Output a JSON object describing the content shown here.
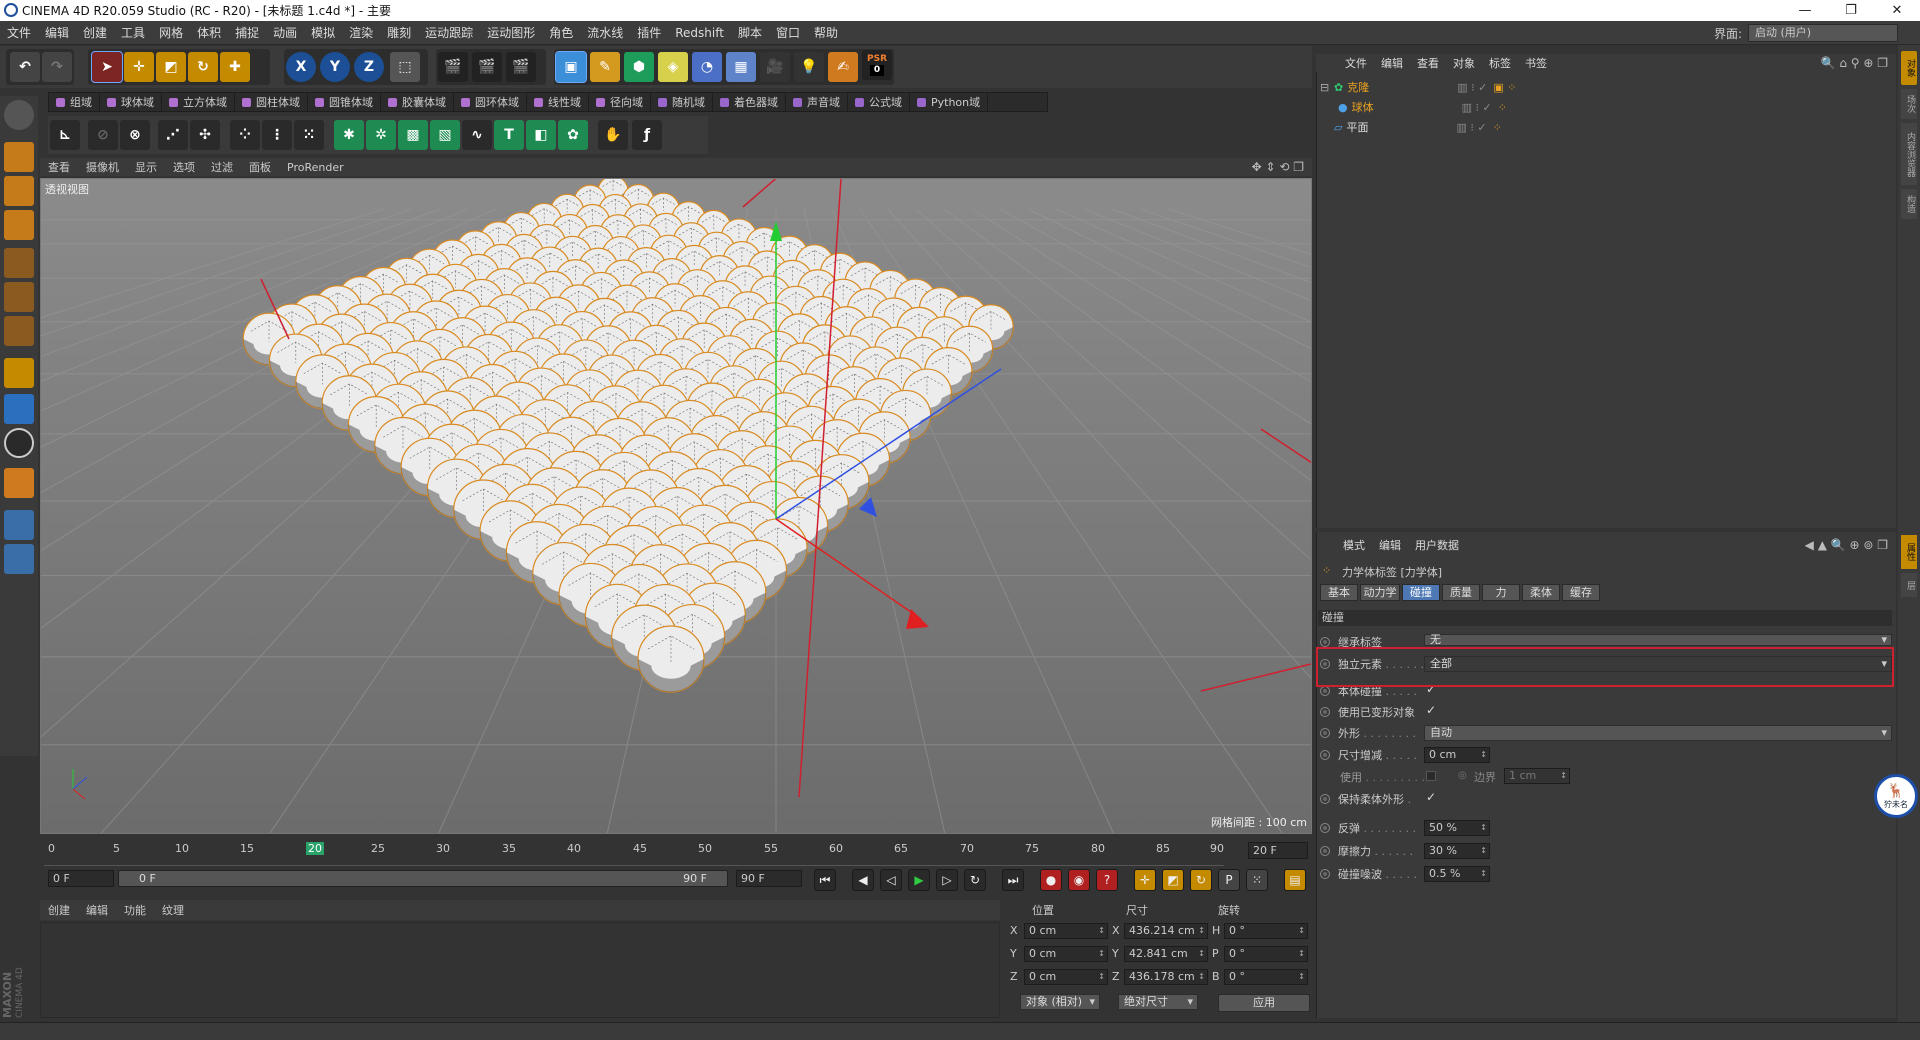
{
  "window": {
    "title": "CINEMA 4D R20.059 Studio (RC - R20) - [未标题 1.c4d *] - 主要",
    "min": "—",
    "max": "❐",
    "close": "✕"
  },
  "menubar": {
    "items": [
      "文件",
      "编辑",
      "创建",
      "工具",
      "网格",
      "体积",
      "捕捉",
      "动画",
      "模拟",
      "渲染",
      "雕刻",
      "运动跟踪",
      "运动图形",
      "角色",
      "流水线",
      "插件",
      "Redshift",
      "脚本",
      "窗口",
      "帮助"
    ],
    "layout_label": "界面:",
    "layout_value": "启动 (用户)"
  },
  "toolbar": {
    "psr_label": "PSR",
    "psr_value": "0",
    "x": "X",
    "y": "Y",
    "z": "Z"
  },
  "fieldbar": {
    "items": [
      {
        "label": "组域",
        "color": "#b070d0"
      },
      {
        "label": "球体域",
        "color": "#b070d0"
      },
      {
        "label": "立方体域",
        "color": "#b070d0"
      },
      {
        "label": "圆柱体域",
        "color": "#b070d0"
      },
      {
        "label": "圆锥体域",
        "color": "#b070d0"
      },
      {
        "label": "胶囊体域",
        "color": "#b070d0"
      },
      {
        "label": "圆环体域",
        "color": "#b070d0"
      },
      {
        "label": "线性域",
        "color": "#b070d0"
      },
      {
        "label": "径向域",
        "color": "#b070d0"
      },
      {
        "label": "随机域",
        "color": "#9966cc"
      },
      {
        "label": "着色器域",
        "color": "#9966cc"
      },
      {
        "label": "声音域",
        "color": "#9966cc"
      },
      {
        "label": "公式域",
        "color": "#9966cc"
      },
      {
        "label": "Python域",
        "color": "#9966cc"
      }
    ]
  },
  "viewport": {
    "menu": [
      "查看",
      "摄像机",
      "显示",
      "选项",
      "过滤",
      "面板",
      "ProRender"
    ],
    "label": "透视视图",
    "grid_info": "网格间距 : 100 cm"
  },
  "timeline": {
    "ticks": [
      "0",
      "5",
      "10",
      "15",
      "20",
      "25",
      "30",
      "35",
      "40",
      "45",
      "50",
      "55",
      "60",
      "65",
      "70",
      "75",
      "80",
      "85",
      "90"
    ],
    "current_frame": 20,
    "end_frame_box": "20 F",
    "start": "0 F",
    "range_start": "0 F",
    "range_end": "90 F",
    "end": "90 F"
  },
  "material": {
    "menu": [
      "创建",
      "编辑",
      "功能",
      "纹理"
    ]
  },
  "coords": {
    "headers": [
      "位置",
      "尺寸",
      "旋转"
    ],
    "rows": [
      {
        "axis": "X",
        "pos": "0 cm",
        "size_axis": "X",
        "size": "436.214 cm",
        "rot_axis": "H",
        "rot": "0 °"
      },
      {
        "axis": "Y",
        "pos": "0 cm",
        "size_axis": "Y",
        "size": "42.841 cm",
        "rot_axis": "P",
        "rot": "0 °"
      },
      {
        "axis": "Z",
        "pos": "0 cm",
        "size_axis": "Z",
        "size": "436.178 cm",
        "rot_axis": "B",
        "rot": "0 °"
      }
    ],
    "mode": "对象 (相对)",
    "size_mode": "绝对尺寸",
    "apply": "应用"
  },
  "object_manager": {
    "menu": [
      "文件",
      "编辑",
      "查看",
      "对象",
      "标签",
      "书签"
    ],
    "objects": [
      {
        "name": "克隆",
        "color": "#e8a020",
        "indent": 0
      },
      {
        "name": "球体",
        "color": "#e8a020",
        "indent": 1
      },
      {
        "name": "平面",
        "color": "#dddddd",
        "indent": 0
      }
    ]
  },
  "attributes": {
    "menu": [
      "模式",
      "编辑",
      "用户数据"
    ],
    "title": "力学体标签 [力学体]",
    "tabs": [
      "基本",
      "动力学",
      "碰撞",
      "质量",
      "力",
      "柔体",
      "缓存"
    ],
    "active_tab": "碰撞",
    "section": "碰撞",
    "props": {
      "inherit_label": "继承标签",
      "inherit_value": "无",
      "standalone_label": "独立元素",
      "standalone_value": "全部",
      "self_collision_label": "本体碰撞",
      "use_deformed_label": "使用已变形对象",
      "shape_label": "外形",
      "shape_value": "自动",
      "size_inc_label": "尺寸增减",
      "size_inc_value": "0 cm",
      "use_label": "使用",
      "border_label": "边界",
      "border_value": "1 cm",
      "keep_soft_label": "保持柔体外形",
      "bounce_label": "反弹",
      "bounce_value": "50 %",
      "friction_label": "摩擦力",
      "friction_value": "30 %",
      "noise_label": "碰撞噪波",
      "noise_value": "0.5 %"
    }
  },
  "side_tabs": [
    "对象",
    "场次",
    "内容浏览器",
    "构造",
    "属性",
    "层"
  ],
  "brand": {
    "maxon": "MAXON",
    "c4d": "CINEMA 4D"
  },
  "badge": {
    "text": "狞未名"
  }
}
